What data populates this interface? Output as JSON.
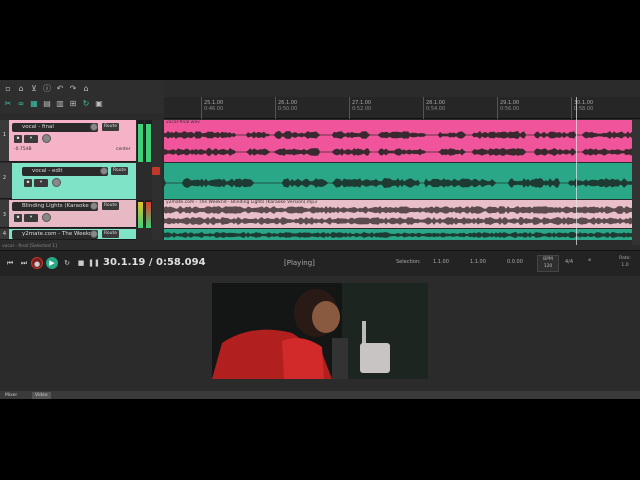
{
  "ruler": {
    "ticks": [
      {
        "label": "25.1.00",
        "sub": "0:46.00"
      },
      {
        "label": "26.1.00",
        "sub": "0:50.00"
      },
      {
        "label": "27.1.00",
        "sub": "0:52.00"
      },
      {
        "label": "28.1.00",
        "sub": "0:54.00"
      },
      {
        "label": "29.1.00",
        "sub": "0:56.00"
      },
      {
        "label": "30.1.00",
        "sub": "0:58.00"
      }
    ]
  },
  "tracks": [
    {
      "number": "1",
      "name": "vocal - final",
      "route": "Route",
      "vol": "-0.75dB",
      "pan": "center",
      "color": "#f5b3c8"
    },
    {
      "number": "2",
      "name": "vocal - edit",
      "route": "Route",
      "color": "#7fe3c7"
    },
    {
      "number": "3",
      "name": "Blinding Lights (Karaoke",
      "route": "Route",
      "color": "#e6b9c4"
    },
    {
      "number": "4",
      "name": "y2mate.com - The Weekn",
      "route": "Route",
      "color": "#7fe3c7"
    }
  ],
  "lanes": {
    "lane1_title": "vocal-final.wav",
    "lane2_title": "",
    "lane3_title": "y2mate.com - The Weeknd - Blinding Lights (Karaoke Version).mp3"
  },
  "colors": {
    "pink": "#f0559c",
    "pink_wave": "#3a2a30",
    "teal": "#2aa787",
    "teal_wave": "#1d3b33",
    "karaoke": "#e9bfc9",
    "karaoke_wave": "#5b4a4e"
  },
  "statusline": "vocal - final [Selected 1]",
  "transport": {
    "time": "30.1.19 / 0:58.094",
    "state": "[Playing]",
    "selection_label": "Selection:",
    "sel_start": "1.1.00",
    "sel_end": "1.1.00",
    "sel_len": "0.0.00",
    "bpm_label": "BPM",
    "bpm": "120",
    "timesig": "4/4",
    "rate_label": "Rate:",
    "rate": "1.0"
  },
  "bottom_tabs": [
    {
      "label": "Mixer"
    },
    {
      "label": "Video"
    }
  ]
}
